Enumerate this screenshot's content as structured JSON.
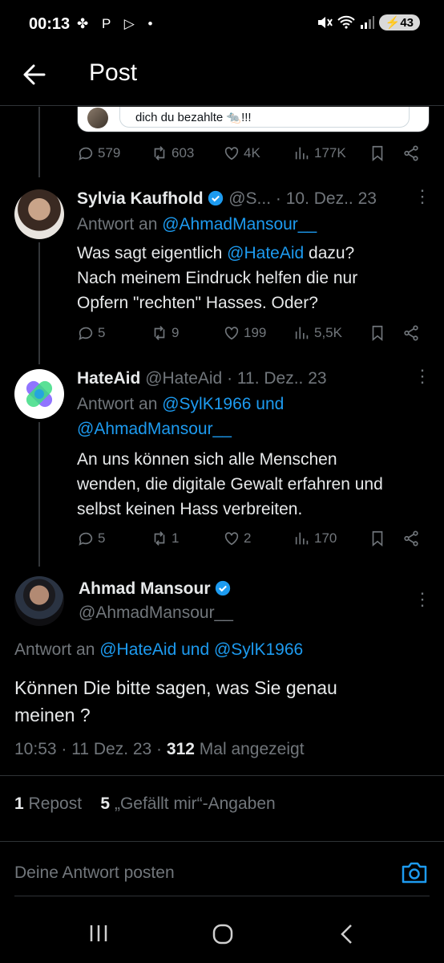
{
  "status_bar": {
    "time": "00:13",
    "left_icons": "✤ P ▷ •",
    "signal": "5",
    "battery": "43"
  },
  "header": {
    "back_icon": "arrow-left-icon",
    "title": "Post"
  },
  "quoted_fragment": {
    "text": "dich du bezahlte 🐀!!!"
  },
  "tweet0_actions": {
    "replies": "579",
    "reposts": "603",
    "likes": "4K",
    "views": "177K"
  },
  "tweets": [
    {
      "name": "Sylvia Kaufhold",
      "handle": "@S...",
      "date": "· 10. Dez.. 23",
      "reply_label": "Antwort an",
      "reply_to": "@AhmadMansour__",
      "body": [
        "Was sagt eigentlich ",
        "@HateAid",
        " dazu?",
        "Nach meinem Eindruck helfen die nur",
        "Opfern \"rechten\" Hasses. Oder?"
      ],
      "replies": "5",
      "reposts": "9",
      "likes": "199",
      "views": "5,5K"
    },
    {
      "name": "HateAid",
      "handle": "@HateAid",
      "date": "· 11. Dez.. 23",
      "reply_label": "Antwort an",
      "reply_to_1": "@SylK1966 und",
      "reply_to_2": "@AhmadMansour__",
      "body": [
        "An uns können sich alle Menschen",
        "wenden, die digitale Gewalt erfahren und",
        "selbst keinen Hass verbreiten."
      ],
      "replies": "5",
      "reposts": "1",
      "likes": "2",
      "views": "170"
    }
  ],
  "main_tweet": {
    "name": "Ahmad Mansour",
    "handle": "@AhmadMansour__",
    "reply_label": "Antwort an",
    "reply_to": "@HateAid und @SylK1966",
    "body_line1": "Können Die bitte sagen, was Sie genau",
    "body_line2": "meinen ?",
    "time": "10:53 · 11 Dez. 23 · ",
    "views": "312",
    "views_label": "Mal angezeigt",
    "reposts_count": "1",
    "reposts_label": "Repost",
    "likes_count": "5",
    "likes_label": "„Gefällt mir“-Angaben"
  },
  "reply_box": {
    "placeholder": "Deine Antwort posten",
    "icon": "camera-icon"
  },
  "nav_bar": {
    "recent": "recents-icon",
    "home": "home-icon",
    "back": "back-icon"
  },
  "colors": {
    "background": "#000000",
    "accent": "#1d9bf0",
    "muted": "#71767b",
    "text": "#e7e9ea"
  }
}
